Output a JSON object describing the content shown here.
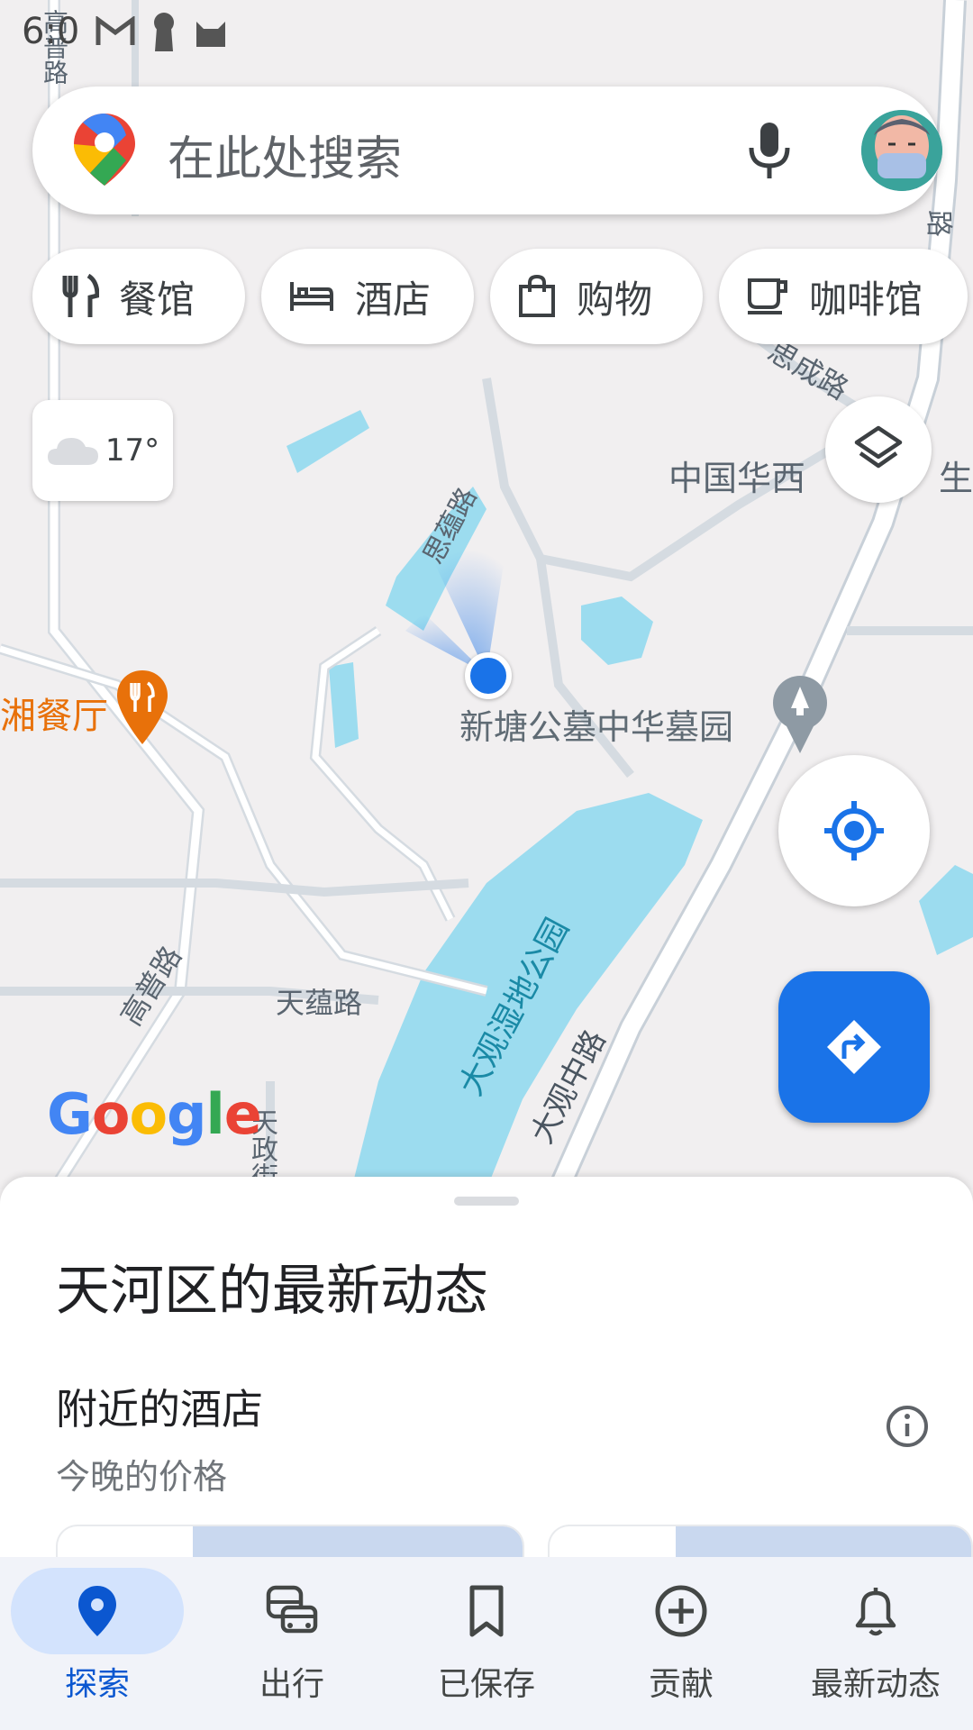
{
  "status_bar": {
    "time": "6:0"
  },
  "search": {
    "placeholder": "在此处搜索"
  },
  "chips": [
    {
      "label": "餐馆",
      "icon": "restaurant-icon"
    },
    {
      "label": "酒店",
      "icon": "hotel-icon"
    },
    {
      "label": "购物",
      "icon": "shopping-bag-icon"
    },
    {
      "label": "咖啡馆",
      "icon": "coffee-icon"
    }
  ],
  "weather": {
    "temperature": "17°",
    "icon": "cloud-icon"
  },
  "map": {
    "labels": {
      "road_gaopu_top": "高普路",
      "road_sicheng": "思成路",
      "road_siyun": "思蕴路",
      "road_tianyun": "天蕴路",
      "road_gaopu": "高普路",
      "road_daguan_zhong": "大观中路",
      "road_tianzheng": "天政街",
      "road_right_edge": "路",
      "park": "大观湿地公园",
      "hospital_partial": "中国华西",
      "hospital_partial_right": "生工",
      "cemetery": "新塘公墓中华墓园",
      "restaurant": "湘餐厅"
    },
    "colors": {
      "water": "#9cdcef",
      "road": "#ffffff",
      "road_outline": "#c8d0d8",
      "poi_orange": "#e8710a",
      "poi_gray": "#70757a",
      "location_blue": "#1a73e8"
    }
  },
  "google_logo": {
    "letters": [
      "G",
      "o",
      "o",
      "g",
      "l",
      "e"
    ]
  },
  "sheet": {
    "title": "天河区的最新动态",
    "section_title": "附近的酒店",
    "section_subtitle": "今晚的价格"
  },
  "bottom_nav": [
    {
      "label": "探索",
      "icon": "explore-pin-icon",
      "active": true
    },
    {
      "label": "出行",
      "icon": "commute-icon",
      "active": false
    },
    {
      "label": "已保存",
      "icon": "bookmark-icon",
      "active": false
    },
    {
      "label": "贡献",
      "icon": "add-circle-icon",
      "active": false
    },
    {
      "label": "最新动态",
      "icon": "notifications-icon",
      "active": false
    }
  ]
}
